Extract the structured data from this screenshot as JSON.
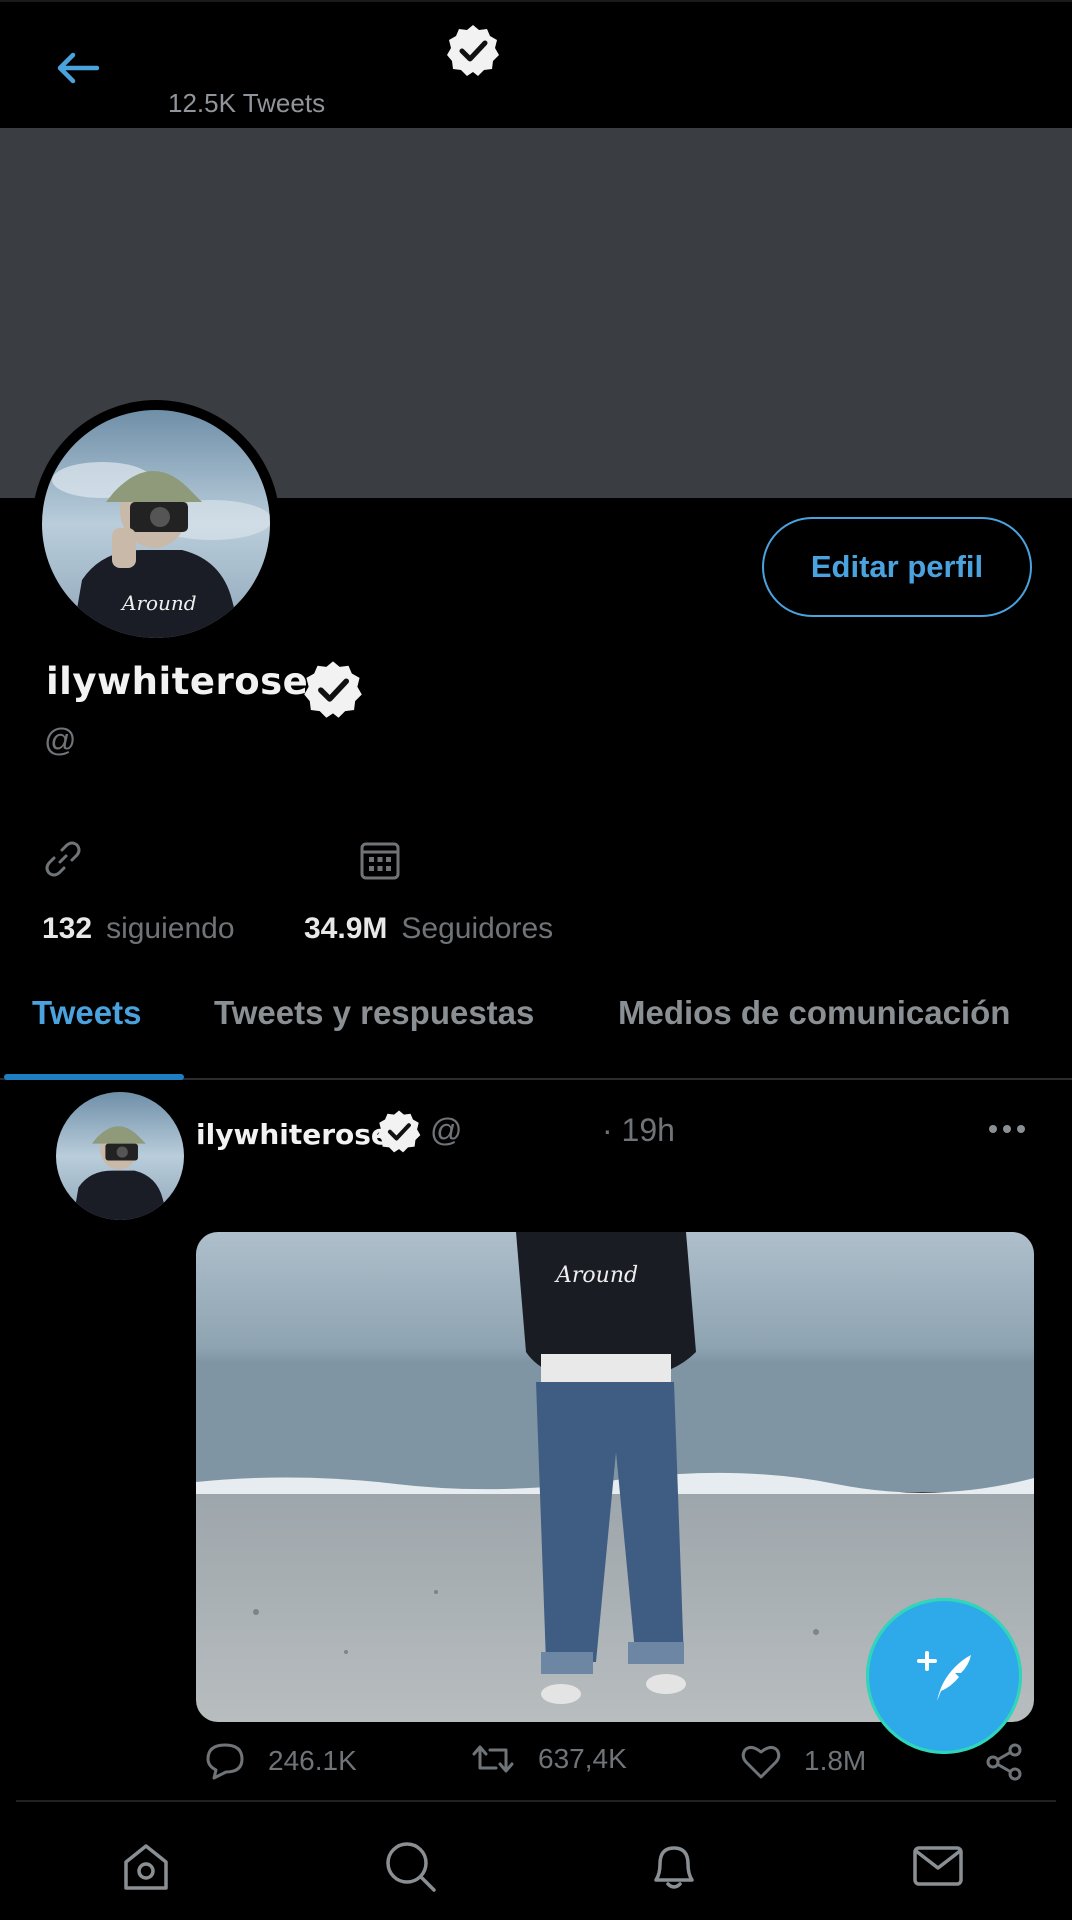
{
  "header": {
    "tweet_count": "12.5K Tweets"
  },
  "profile": {
    "display_name": "ilywhiterose",
    "handle": "@",
    "edit_button_label": "Editar perfil",
    "following_count": "132",
    "following_label": "siguiendo",
    "followers_count": "34.9M",
    "followers_label": "Seguidores"
  },
  "tabs": [
    {
      "label": "Tweets",
      "selected": true
    },
    {
      "label": "Tweets y respuestas",
      "selected": false
    },
    {
      "label": "Medios de comunicación",
      "selected": false
    }
  ],
  "tweet": {
    "author_name": "ilywhiterose",
    "author_handle": "@",
    "time": "· 19h",
    "replies": "246.1K",
    "retweets": "637,4K",
    "likes": "1.8M"
  },
  "icons": {
    "back": "arrow-left-icon",
    "verified": "verified-badge-icon",
    "link": "link-icon",
    "calendar": "calendar-icon",
    "more": "more-horizontal-icon",
    "reply": "comment-icon",
    "retweet": "retweet-icon",
    "like": "heart-icon",
    "share": "share-icon",
    "compose": "compose-feather-icon",
    "home": "home-icon",
    "search": "search-icon",
    "notifications": "bell-icon",
    "messages": "mail-icon"
  },
  "colors": {
    "accent": "#4aa3df",
    "background": "#000000",
    "banner": "#3a3d42",
    "secondary_text": "#6f7478",
    "fab": "#2ea9ea"
  }
}
